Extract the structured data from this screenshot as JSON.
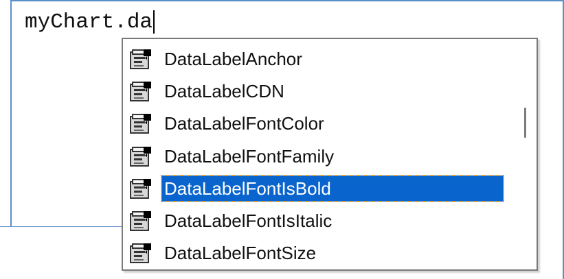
{
  "editor": {
    "code_text": "myChart.da"
  },
  "autocomplete": {
    "item_icon": "property-icon",
    "selected_index": 4,
    "items": [
      {
        "label": "DataLabelAnchor"
      },
      {
        "label": "DataLabelCDN"
      },
      {
        "label": "DataLabelFontColor"
      },
      {
        "label": "DataLabelFontFamily"
      },
      {
        "label": "DataLabelFontIsBold"
      },
      {
        "label": "DataLabelFontIsItalic"
      },
      {
        "label": "DataLabelFontSize"
      }
    ],
    "colors": {
      "selection_bg": "#0a64cd",
      "selection_text": "#ffffff",
      "frame_border": "#5b8fc9"
    }
  }
}
